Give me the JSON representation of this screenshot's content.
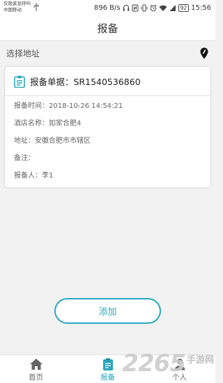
{
  "status_bar": {
    "carrier_line1": "仅限紧急呼叫",
    "carrier_line2": "中国移动",
    "speed": "896 B/s",
    "battery": "92",
    "time": "15:56"
  },
  "header": {
    "title": "报备"
  },
  "address": {
    "label": "选择地址",
    "icon": "location-pin-icon"
  },
  "report_card": {
    "title": "报备单据：SR1540536860",
    "icon": "clipboard-icon",
    "lines": [
      "报备时间：2018-10-26 14:54:21",
      "酒店名称：如家合肥4",
      "地址：安徽合肥市市辖区",
      "备注：",
      "报备人：李1"
    ]
  },
  "add_button": {
    "label": "添加"
  },
  "tab_bar": {
    "items": [
      {
        "label": "首页",
        "icon": "home-icon",
        "active": false
      },
      {
        "label": "报备",
        "icon": "clipboard-icon",
        "active": true
      },
      {
        "label": "个人",
        "icon": "user-icon",
        "active": false
      }
    ]
  },
  "watermark": {
    "number": "2265",
    "text": "手游网"
  },
  "colors": {
    "accent": "#2aa8be",
    "background": "#f2f2f2"
  }
}
